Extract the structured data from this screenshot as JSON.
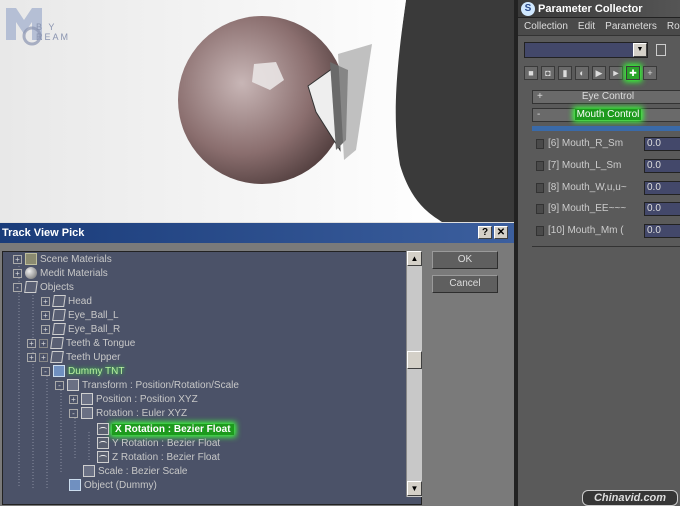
{
  "trackview": {
    "title": "Track View Pick",
    "help_glyph": "?",
    "close_glyph": "✕",
    "ok_label": "OK",
    "cancel_label": "Cancel",
    "tree": [
      {
        "label": "Scene Materials",
        "expander": "+",
        "icon": "folder-icon"
      },
      {
        "label": "Medit Materials",
        "expander": "+",
        "icon": "material-icon"
      },
      {
        "label": "Objects",
        "expander": "-",
        "icon": "folder-icon"
      },
      {
        "label": "Head",
        "expander": "+",
        "icon": "cube-icon"
      },
      {
        "label": "Eye_Ball_L",
        "expander": "+",
        "icon": "cube-icon"
      },
      {
        "label": "Eye_Ball_R",
        "expander": "+",
        "icon": "cube-icon"
      },
      {
        "label": "Teeth & Tongue",
        "expander": "+",
        "icon": "cube-icon"
      },
      {
        "label": "Teeth Upper",
        "expander": "+",
        "icon": "cube-icon"
      },
      {
        "label": "Dummy TNT",
        "expander": "-",
        "icon": "dummy-icon"
      },
      {
        "label": "Transform : Position/Rotation/Scale",
        "expander": "-",
        "icon": "controller-icon"
      },
      {
        "label": "Position : Position XYZ",
        "expander": "+",
        "icon": "controller-icon"
      },
      {
        "label": "Rotation : Euler XYZ",
        "expander": "-",
        "icon": "controller-icon"
      },
      {
        "label": "X Rotation : Bezier Float",
        "expander": "",
        "icon": "curve-icon"
      },
      {
        "label": "Y Rotation : Bezier Float",
        "expander": "",
        "icon": "curve-icon"
      },
      {
        "label": "Z Rotation : Bezier Float",
        "expander": "",
        "icon": "curve-icon"
      },
      {
        "label": "Scale : Bezier Scale",
        "expander": "",
        "icon": "controller-icon"
      },
      {
        "label": "Object (Dummy)",
        "expander": "",
        "icon": "dummy-icon"
      }
    ]
  },
  "collector": {
    "title": "Parameter Collector",
    "logo_glyph": "S",
    "menu": [
      "Collection",
      "Edit",
      "Parameters",
      "Roll"
    ],
    "rollouts": [
      {
        "sign": "+",
        "label": "Eye Control"
      },
      {
        "sign": "-",
        "label": "Mouth Control"
      }
    ],
    "params": [
      {
        "name": "[6] Mouth_R_Sm",
        "value": "0.0"
      },
      {
        "name": "[7] Mouth_L_Sm",
        "value": "0.0"
      },
      {
        "name": "[8] Mouth_W,u,u~",
        "value": "0.0"
      },
      {
        "name": "[9] Mouth_EE~~~",
        "value": "0.0"
      },
      {
        "name": "[10] Mouth_Mm (",
        "value": "0.0"
      }
    ]
  },
  "viewport": {
    "logo_text": "B Y REAM"
  },
  "watermark": "Chinavid.com",
  "colors": {
    "highlight_green": "#1d9a1d",
    "title_blue": "#1a3c7a",
    "tree_bg": "#4b5268"
  }
}
